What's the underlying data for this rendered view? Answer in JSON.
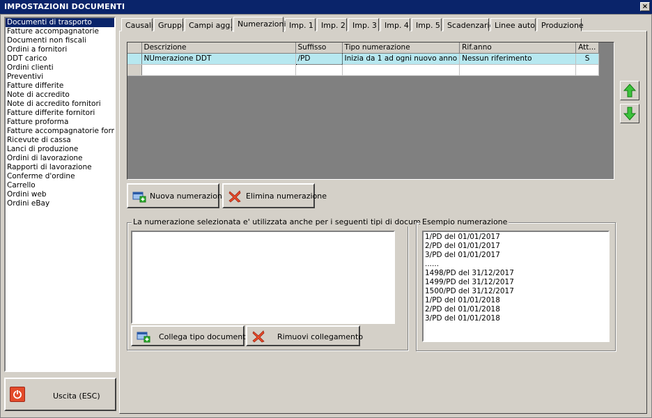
{
  "window": {
    "title": "IMPOSTAZIONI DOCUMENTI",
    "close_glyph": "×"
  },
  "doc_types": [
    "Documenti di trasporto",
    "Fatture accompagnatorie",
    "Documenti non fiscali",
    "Ordini a fornitori",
    "DDT carico",
    "Ordini clienti",
    "Preventivi",
    "Fatture differite",
    "Note di accredito",
    "Note di accredito fornitori",
    "Fatture differite fornitori",
    "Fatture proforma",
    "Fatture accompagnatorie fornito",
    "Ricevute di cassa",
    "Lanci di produzione",
    "Ordini di lavorazione",
    "Rapporti di lavorazione",
    "Conferme d'ordine",
    "Carrello",
    "Ordini web",
    "Ordini eBay"
  ],
  "selected_doc_type": "Documenti di trasporto",
  "exit_button": {
    "label": "Uscita (ESC)",
    "icon": "power-icon"
  },
  "tabs": [
    {
      "label": "Causali"
    },
    {
      "label": "Gruppi"
    },
    {
      "label": "Campi agg."
    },
    {
      "label": "Numerazioni"
    },
    {
      "label": "Imp. 1"
    },
    {
      "label": "Imp. 2"
    },
    {
      "label": "Imp. 3"
    },
    {
      "label": "Imp. 4"
    },
    {
      "label": "Imp. 5"
    },
    {
      "label": "Scadenzario"
    },
    {
      "label": "Linee auto"
    },
    {
      "label": "Produzione"
    }
  ],
  "active_tab": "Numerazioni",
  "grid": {
    "columns": [
      "Descrizione",
      "Suffisso",
      "Tipo numerazione",
      "Rif.anno",
      "Att..."
    ],
    "rows": [
      [
        "NUmerazione DDT",
        "/PD",
        "Inizia da 1 ad ogni nuovo anno",
        "Nessun riferimento",
        "S"
      ]
    ]
  },
  "buttons": {
    "new_numbering": "Nuova numerazione",
    "delete_numbering": "Elimina numerazione",
    "link_doc_type": "Collega tipo documento",
    "remove_link": "Rimuovi collegamento"
  },
  "linked_group": {
    "legend": "La numerazione selezionata e' utilizzata anche per i seguenti tipi di documenti...",
    "items": []
  },
  "example_group": {
    "legend": "Esempio numerazione",
    "lines": [
      "1/PD del 01/01/2017",
      "2/PD del 01/01/2017",
      "3/PD del 01/01/2017",
      "......",
      "1498/PD del 31/12/2017",
      "1499/PD del 31/12/2017",
      "1500/PD del 31/12/2017",
      "1/PD del 01/01/2018",
      "2/PD del 01/01/2018",
      "3/PD del 01/01/2018"
    ]
  },
  "colors": {
    "title_bar": "#0a246a",
    "selected_row": "#b7e8f0",
    "grid_bg": "#808080"
  }
}
